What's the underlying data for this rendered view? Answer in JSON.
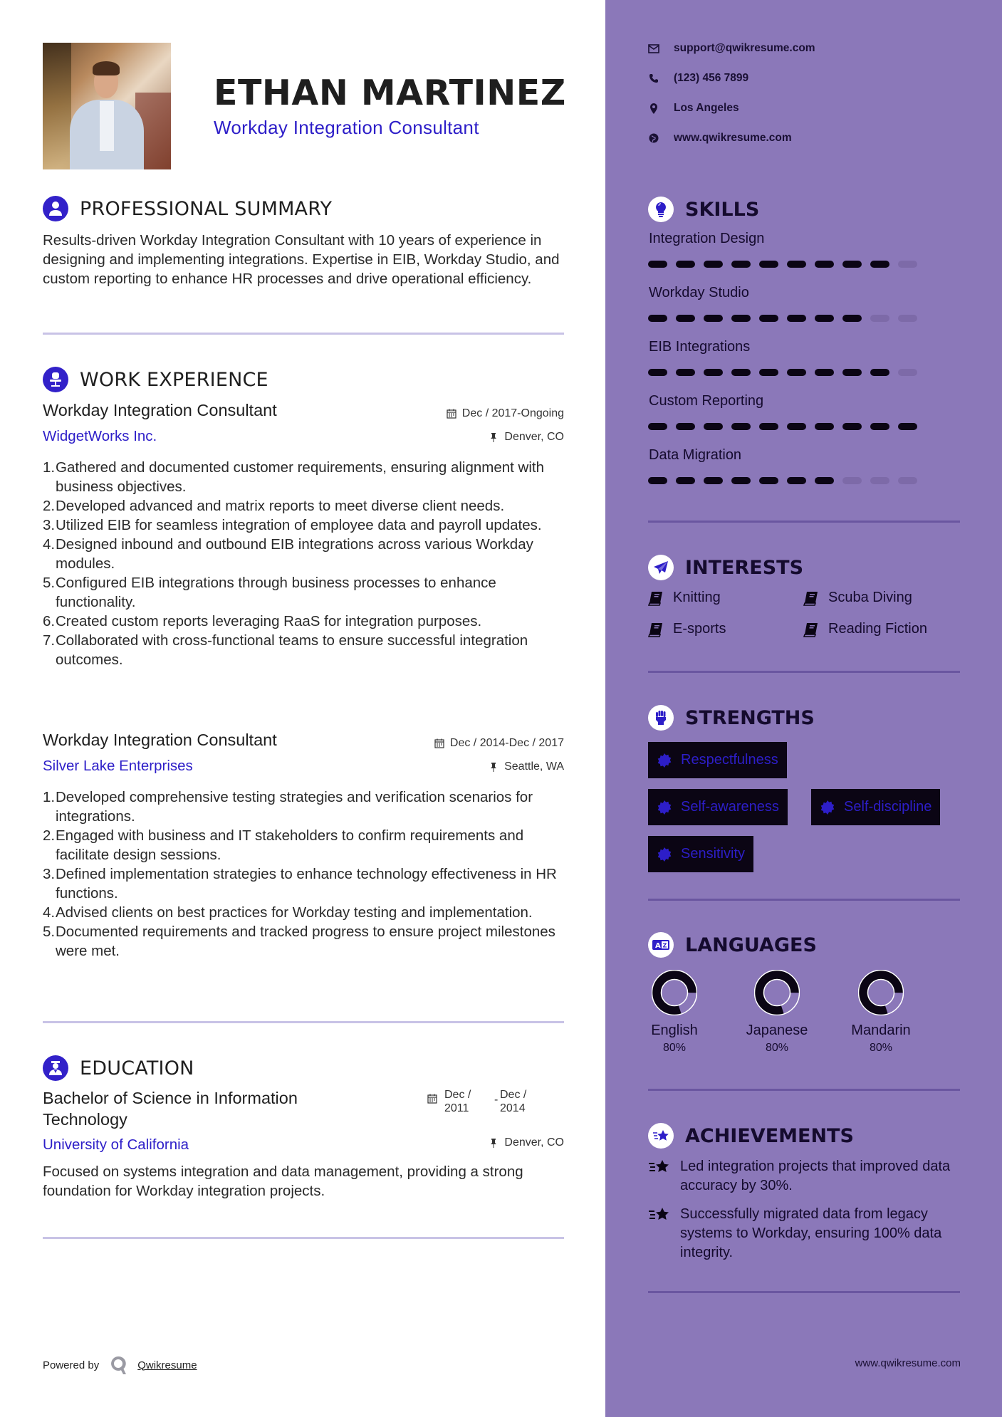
{
  "header": {
    "name": "ETHAN MARTINEZ",
    "role": "Workday Integration Consultant",
    "photo_alt": "profile-photo"
  },
  "summary": {
    "title": "PROFESSIONAL SUMMARY",
    "icon": "user-icon",
    "text": "Results-driven Workday Integration Consultant with 10 years of experience in designing and implementing integrations. Expertise in EIB, Workday Studio, and custom reporting to enhance HR processes and drive operational efficiency."
  },
  "experience": {
    "title": "WORK EXPERIENCE",
    "icon": "office-chair-icon",
    "jobs": [
      {
        "title": "Workday Integration Consultant",
        "dates": "Dec / 2017-Ongoing",
        "company": "WidgetWorks Inc.",
        "location": "Denver, CO",
        "bullets": [
          "Gathered and documented customer requirements, ensuring alignment with business objectives.",
          "Developed advanced and matrix reports to meet diverse client needs.",
          "Utilized EIB for seamless integration of employee data and payroll updates.",
          "Designed inbound and outbound EIB integrations across various Workday modules.",
          "Configured EIB integrations through business processes to enhance functionality.",
          "Created custom reports leveraging RaaS for integration purposes.",
          "Collaborated with cross-functional teams to ensure successful integration outcomes."
        ]
      },
      {
        "title": "Workday Integration Consultant",
        "dates": "Dec / 2014-Dec / 2017",
        "company": "Silver Lake Enterprises",
        "location": "Seattle, WA",
        "bullets": [
          "Developed comprehensive testing strategies and verification scenarios for integrations.",
          "Engaged with business and IT stakeholders to confirm requirements and facilitate design sessions.",
          "Defined implementation strategies to enhance technology effectiveness in HR functions.",
          "Advised clients on best practices for Workday testing and implementation.",
          "Documented requirements and tracked progress to ensure project milestones were met."
        ]
      }
    ]
  },
  "education": {
    "title": "EDUCATION",
    "icon": "graduate-icon",
    "degree": "Bachelor of Science in Information Technology",
    "start": "Dec / 2011",
    "separator": "-",
    "end": "Dec / 2014",
    "school": "University of California",
    "location": "Denver, CO",
    "description": "Focused on systems integration and data management, providing a strong foundation for Workday integration projects."
  },
  "footer": {
    "powered_by": "Powered by",
    "brand": "Qwikresume",
    "site": "www.qwikresume.com"
  },
  "contact": {
    "email": "support@qwikresume.com",
    "phone": "(123) 456 7899",
    "location": "Los Angeles",
    "website": "www.qwikresume.com"
  },
  "skills": {
    "title": "SKILLS",
    "icon": "lightbulb-icon",
    "max": 10,
    "items": [
      {
        "name": "Integration Design",
        "level": 9
      },
      {
        "name": "Workday Studio",
        "level": 8
      },
      {
        "name": "EIB Integrations",
        "level": 9
      },
      {
        "name": "Custom Reporting",
        "level": 10
      },
      {
        "name": "Data Migration",
        "level": 7
      }
    ]
  },
  "interests": {
    "title": "INTERESTS",
    "icon": "paper-plane-icon",
    "items": [
      "Knitting",
      "Scuba Diving",
      "E-sports",
      "Reading Fiction"
    ]
  },
  "strengths": {
    "title": "STRENGTHS",
    "icon": "fist-icon",
    "items": [
      "Respectfulness",
      "Self-awareness",
      "Self-discipline",
      "Sensitivity"
    ]
  },
  "languages": {
    "title": "LANGUAGES",
    "icon": "translate-icon",
    "items": [
      {
        "name": "English",
        "percent_label": "80%",
        "value": 80
      },
      {
        "name": "Japanese",
        "percent_label": "80%",
        "value": 80
      },
      {
        "name": "Mandarin",
        "percent_label": "80%",
        "value": 80
      }
    ]
  },
  "achievements": {
    "title": "ACHIEVEMENTS",
    "icon": "star-icon",
    "items": [
      "Led integration projects that improved data accuracy by 30%.",
      "Successfully migrated data from legacy systems to Workday, ensuring 100% data integrity."
    ]
  },
  "colors": {
    "accent": "#2d1ec8",
    "sidebar": "#8b78b9",
    "divider_light": "#c8c3e6",
    "dark": "#0b0514"
  }
}
